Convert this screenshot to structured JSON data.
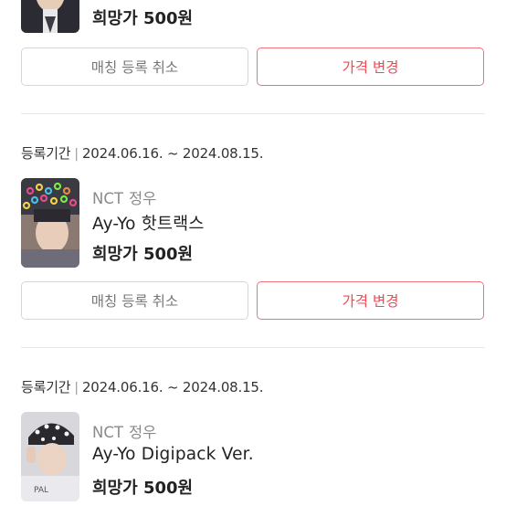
{
  "listings": [
    {
      "artist": "",
      "member": "",
      "title": "",
      "price": "희망가 500원",
      "cancel_label": "매칭 등록 취소",
      "change_price_label": "가격 변경"
    },
    {
      "period_label": "등록기간",
      "period_sep": "|",
      "period_range": "2024.06.16. ~ 2024.08.15.",
      "artist": "NCT",
      "member": "정우",
      "title": "Ay-Yo 핫트랙스",
      "price": "희망가 500원",
      "cancel_label": "매칭 등록 취소",
      "change_price_label": "가격 변경"
    },
    {
      "period_label": "등록기간",
      "period_sep": "|",
      "period_range": "2024.06.16. ~ 2024.08.15.",
      "artist": "NCT",
      "member": "정우",
      "title": "Ay-Yo Digipack Ver.",
      "price": "희망가 500원"
    }
  ],
  "colors": {
    "accent": "#ec4a53",
    "accent_border": "#f0737a",
    "neutral_border": "#d6d6d6",
    "divider": "#e6e6e6"
  }
}
